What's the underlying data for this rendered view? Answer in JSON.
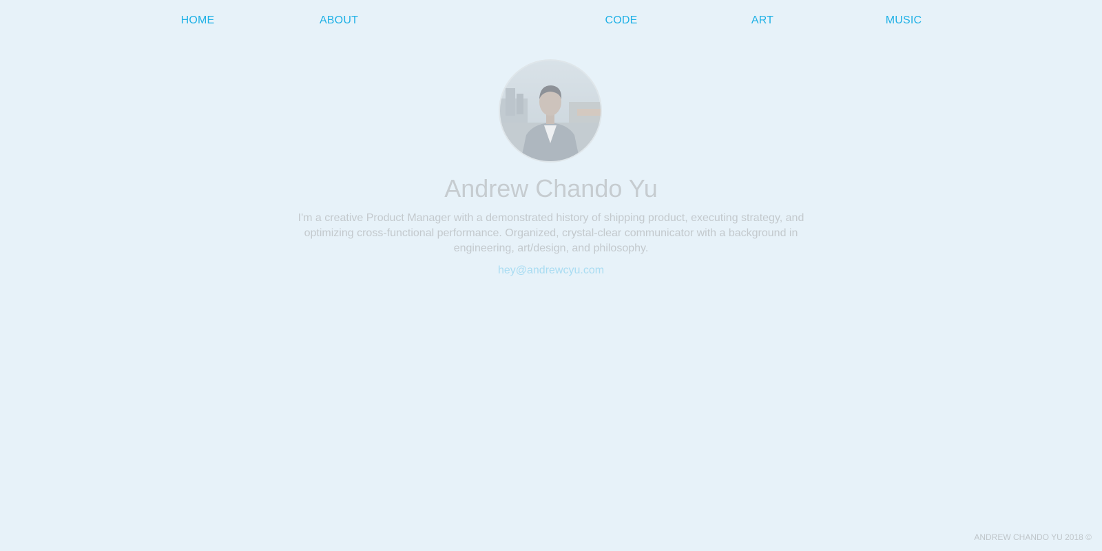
{
  "nav": {
    "items": [
      {
        "label": "HOME"
      },
      {
        "label": "ABOUT"
      },
      {
        "label": "CODE"
      },
      {
        "label": "ART"
      },
      {
        "label": "MUSIC"
      }
    ]
  },
  "profile": {
    "name": "Andrew Chando Yu",
    "bio": "I'm a creative Product Manager with a demonstrated history of shipping product, executing strategy, and optimizing cross-functional performance. Organized, crystal-clear communicator with a background in engineering, art/design, and philosophy.",
    "email": "hey@andrewcyu.com"
  },
  "footer": {
    "text": "ANDREW CHANDO YU 2018 ©"
  },
  "colors": {
    "background": "#e7f2f9",
    "nav_link": "#1fb1e6",
    "email_link": "#a9dcf2",
    "muted_text": "#c3c9cd"
  }
}
